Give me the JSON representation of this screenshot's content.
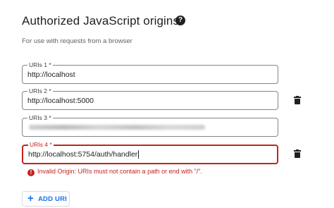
{
  "section": {
    "title": "Authorized JavaScript origins",
    "subtitle": "For use with requests from a browser",
    "help_icon": "help-circle-icon"
  },
  "uris": [
    {
      "label": "URIs 1 *",
      "value": "http://localhost",
      "state": "normal"
    },
    {
      "label": "URIs 2 *",
      "value": "http://localhost:5000",
      "state": "normal"
    },
    {
      "label": "URIs 3 *",
      "value": "",
      "state": "redacted"
    },
    {
      "label": "URIs 4 *",
      "value": "http://localhost:5754/auth/handler",
      "state": "error"
    }
  ],
  "error_message": "Invalid Origin: URIs must not contain a path or end with \"/\".",
  "add_button": {
    "label": "ADD URI",
    "icon": "plus-icon"
  },
  "icons": {
    "delete": "trash-icon",
    "error": "error-icon"
  },
  "colors": {
    "accent": "#1a73e8",
    "error": "#c5221f",
    "text": "#202124",
    "muted": "#5f6368"
  }
}
